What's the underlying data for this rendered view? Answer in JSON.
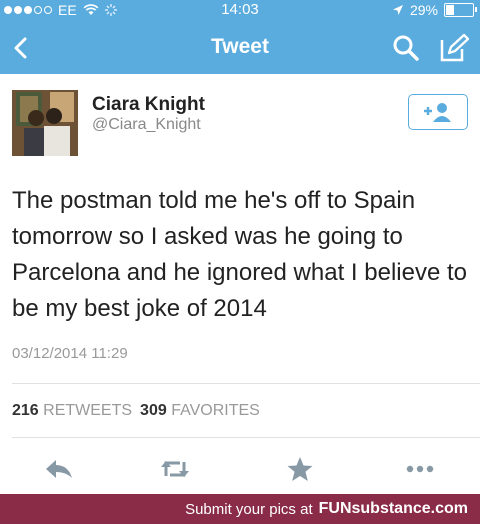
{
  "status_bar": {
    "carrier": "EE",
    "time": "14:03",
    "battery": "29%",
    "battery_level": 0.29
  },
  "nav": {
    "title": "Tweet"
  },
  "profile": {
    "name": "Ciara Knight",
    "handle": "@Ciara_Knight"
  },
  "tweet": {
    "text": "The postman told me he's off to Spain tomorrow so I asked was he going to Parcelona and he ignored what I believe to be my best joke of 2014",
    "timestamp": "03/12/2014 11:29",
    "retweets_count": "216",
    "retweets_label": "RETWEETS",
    "favorites_count": "309",
    "favorites_label": "FAVORITES"
  },
  "actions": [
    "reply-icon",
    "retweet-icon",
    "star-icon",
    "more-icon"
  ],
  "footer": {
    "text": "Submit your pics at",
    "brand": "FUNsubstance.com"
  },
  "colors": {
    "twitter_blue": "#5aacde",
    "footer_bg": "#8a2b47",
    "icon_gray": "#8899a6"
  }
}
